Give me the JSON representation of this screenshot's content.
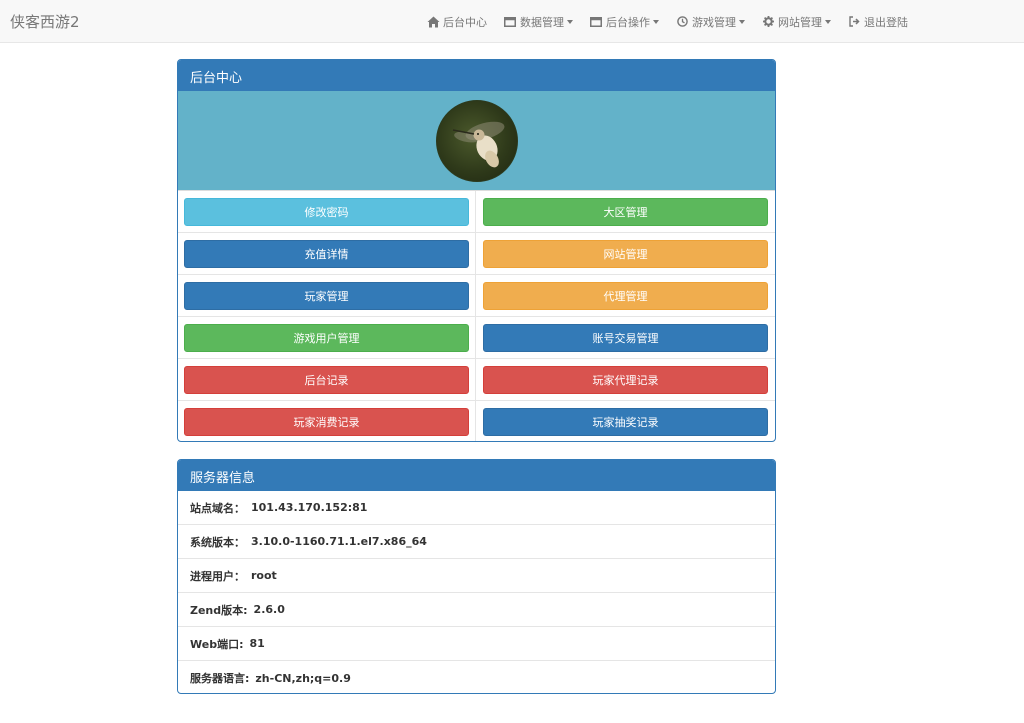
{
  "brand": "侠客西游2",
  "nav": [
    {
      "icon": "home-icon",
      "label": "后台中心",
      "dropdown": false
    },
    {
      "icon": "window-icon",
      "label": "数据管理",
      "dropdown": true
    },
    {
      "icon": "window-icon",
      "label": "后台操作",
      "dropdown": true
    },
    {
      "icon": "clock-icon",
      "label": "游戏管理",
      "dropdown": true
    },
    {
      "icon": "gear-icon",
      "label": "网站管理",
      "dropdown": true
    },
    {
      "icon": "logout-icon",
      "label": "退出登陆",
      "dropdown": false
    }
  ],
  "admin_panel": {
    "title": "后台中心",
    "banner_color": "#63b2c9",
    "buttons": [
      {
        "label": "修改密码",
        "color": "info"
      },
      {
        "label": "大区管理",
        "color": "success"
      },
      {
        "label": "充值详情",
        "color": "primary"
      },
      {
        "label": "网站管理",
        "color": "warning"
      },
      {
        "label": "玩家管理",
        "color": "primary"
      },
      {
        "label": "代理管理",
        "color": "warning"
      },
      {
        "label": "游戏用户管理",
        "color": "success"
      },
      {
        "label": "账号交易管理",
        "color": "primary"
      },
      {
        "label": "后台记录",
        "color": "danger"
      },
      {
        "label": "玩家代理记录",
        "color": "danger"
      },
      {
        "label": "玩家消费记录",
        "color": "danger"
      },
      {
        "label": "玩家抽奖记录",
        "color": "primary"
      }
    ]
  },
  "server_panel": {
    "title": "服务器信息",
    "rows": [
      {
        "label": "站点域名：",
        "value": "101.43.170.152:81"
      },
      {
        "label": "系统版本：",
        "value": "3.10.0-1160.71.1.el7.x86_64"
      },
      {
        "label": "进程用户：",
        "value": "root"
      },
      {
        "label": "Zend版本:",
        "value": "2.6.0"
      },
      {
        "label": "Web端口:",
        "value": "81"
      },
      {
        "label": "服务器语言:",
        "value": "zh-CN,zh;q=0.9"
      }
    ]
  },
  "colors": {
    "primary": "#337ab7",
    "info": "#5bc0de",
    "success": "#5cb85c",
    "warning": "#f0ad4e",
    "danger": "#d9534f"
  }
}
